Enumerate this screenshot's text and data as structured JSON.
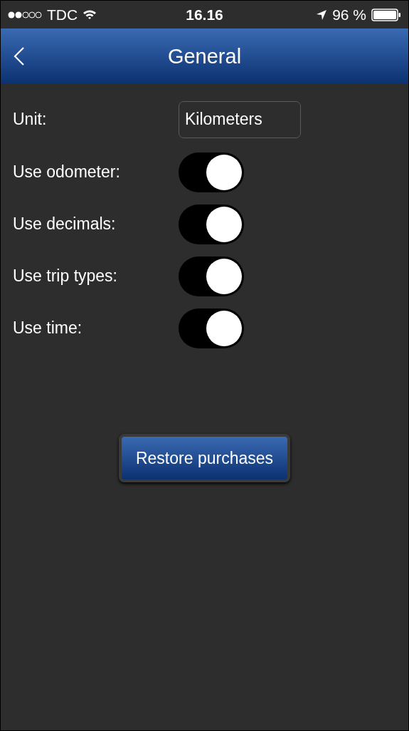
{
  "status_bar": {
    "carrier": "TDC",
    "time": "16.16",
    "battery": "96 %"
  },
  "nav_bar": {
    "title": "General"
  },
  "unit": {
    "label": "Unit:",
    "value": "Kilometers"
  },
  "settings": [
    {
      "label": "Use odometer:",
      "on": true
    },
    {
      "label": "Use decimals:",
      "on": true
    },
    {
      "label": "Use trip types:",
      "on": true
    },
    {
      "label": "Use time:",
      "on": true
    }
  ],
  "restore_button": "Restore purchases"
}
